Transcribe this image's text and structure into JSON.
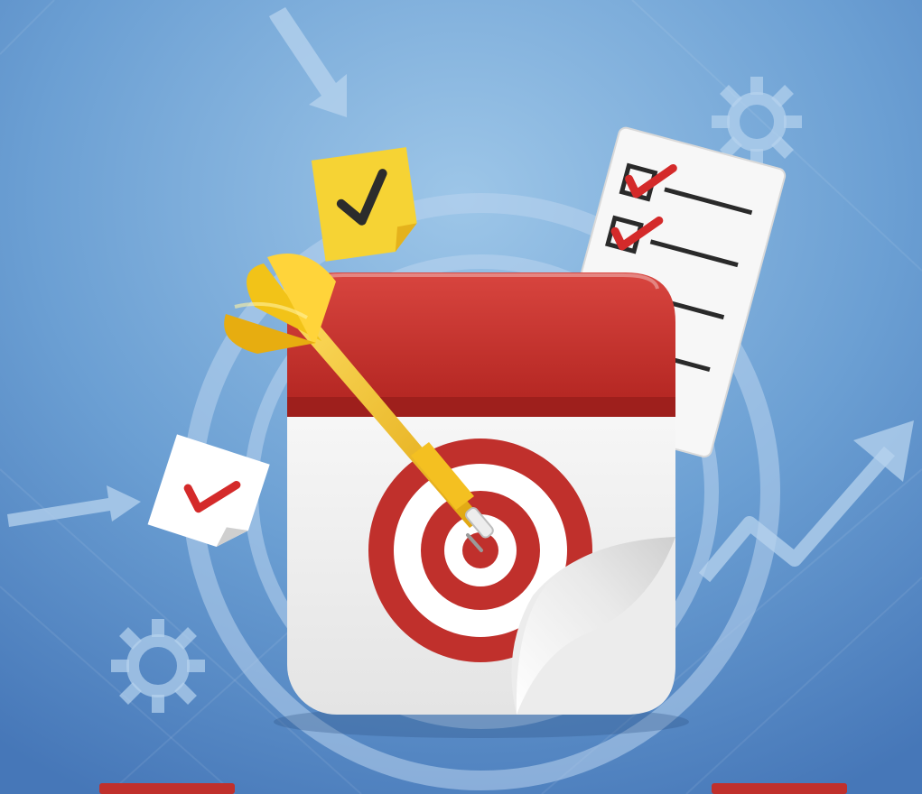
{
  "scene": {
    "subject": "calendar-target-dart-illustration",
    "colors": {
      "background_top": "#8fbbe0",
      "background_bottom": "#4a7fbf",
      "ring": "#b7d3ee",
      "calendar_red": "#c0302c",
      "calendar_red_dark": "#9e1f1c",
      "calendar_white": "#f4f4f4",
      "dart_yellow": "#f2c318",
      "dart_yellow_dark": "#d99f0c",
      "checkmark_red": "#d42a2a",
      "note_yellow": "#f6d334"
    },
    "icons": [
      "calendar-icon",
      "target-icon",
      "dart-icon",
      "checklist-icon",
      "sticky-note-icon",
      "gear-icon",
      "arrow-icon",
      "growth-arrow-icon"
    ]
  }
}
